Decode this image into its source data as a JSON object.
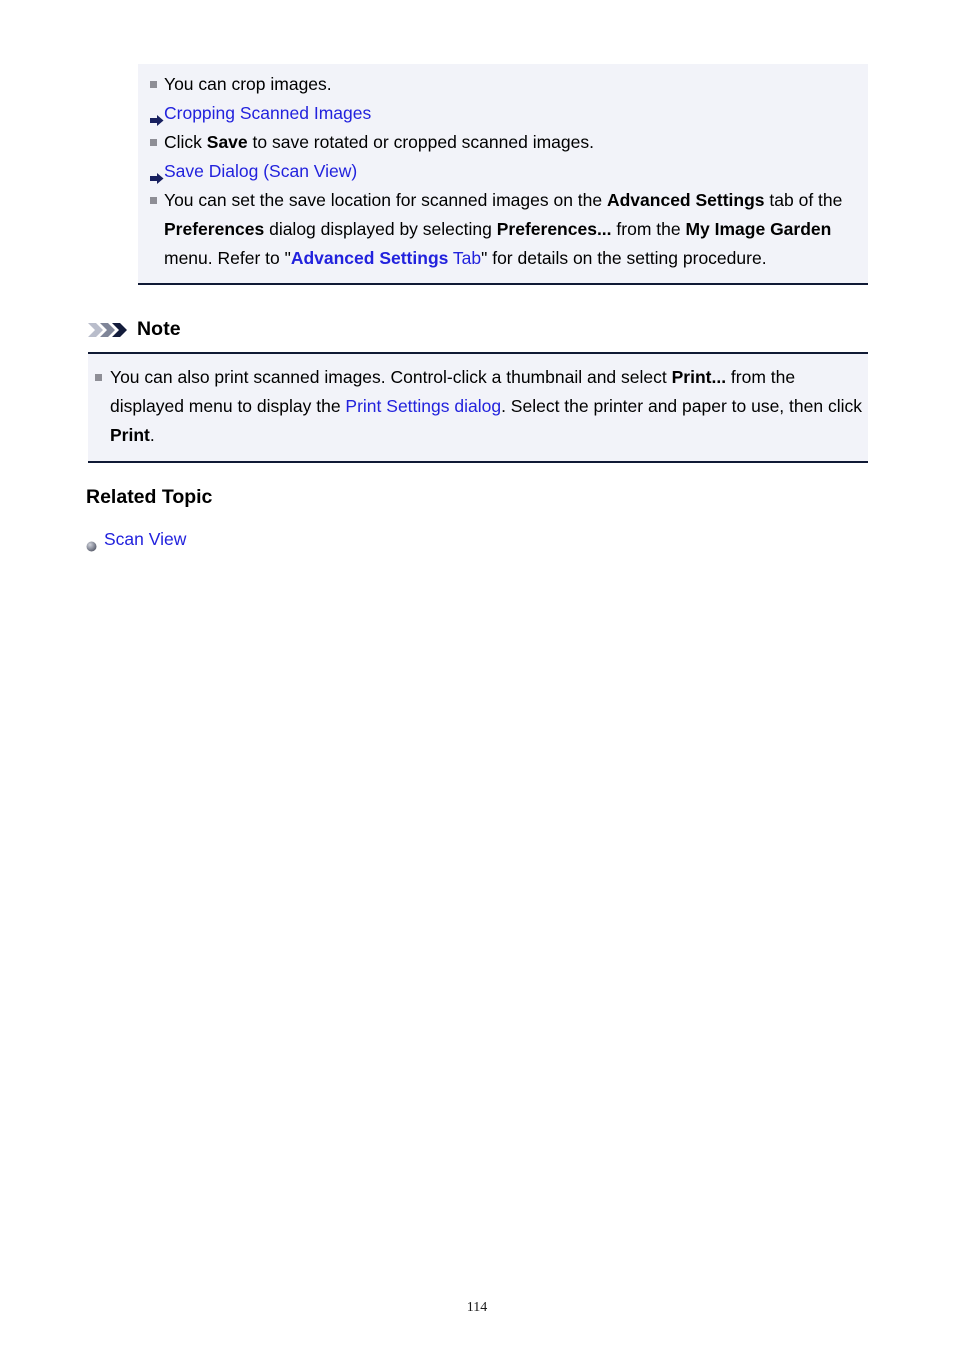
{
  "page": {
    "number": "114"
  },
  "info_panel": {
    "items": [
      {
        "type": "bullet",
        "segments": [
          {
            "text": "You can crop images.",
            "style": "normal"
          }
        ]
      },
      {
        "type": "arrow-link",
        "icon": "arrow-right-icon",
        "segments": [
          {
            "text": "Cropping Scanned Images",
            "style": "link"
          }
        ]
      },
      {
        "type": "bullet",
        "segments": [
          {
            "text": "Click ",
            "style": "normal"
          },
          {
            "text": "Save",
            "style": "bold"
          },
          {
            "text": " to save rotated or cropped scanned images.",
            "style": "normal"
          }
        ]
      },
      {
        "type": "arrow-link",
        "icon": "arrow-right-icon",
        "segments": [
          {
            "text": "Save Dialog (Scan View)",
            "style": "link"
          }
        ]
      },
      {
        "type": "bullet",
        "segments": [
          {
            "text": "You can set the save location for scanned images on the ",
            "style": "normal"
          },
          {
            "text": "Advanced Settings",
            "style": "bold"
          },
          {
            "text": " tab of the ",
            "style": "normal"
          },
          {
            "text": "Preferences",
            "style": "bold"
          },
          {
            "text": " dialog displayed by selecting ",
            "style": "normal"
          },
          {
            "text": "Preferences...",
            "style": "bold"
          },
          {
            "text": " from the ",
            "style": "normal"
          },
          {
            "text": "My Image Garden",
            "style": "bold"
          },
          {
            "text": " menu. Refer to \"",
            "style": "normal"
          },
          {
            "text": "Advanced Settings",
            "style": "link-bold"
          },
          {
            "text": " Tab",
            "style": "link"
          },
          {
            "text": "\" for details on the setting procedure.",
            "style": "normal"
          }
        ]
      }
    ]
  },
  "note_section": {
    "icon": "triple-chevron-icon",
    "title": "Note",
    "items": [
      {
        "type": "bullet",
        "segments": [
          {
            "text": "You can also print scanned images. Control-click a thumbnail and select ",
            "style": "normal"
          },
          {
            "text": "Print...",
            "style": "bold"
          },
          {
            "text": " from the displayed menu to display the ",
            "style": "normal"
          },
          {
            "text": "Print Settings dialog",
            "style": "link"
          },
          {
            "text": ". Select the printer and paper to use, then click ",
            "style": "normal"
          },
          {
            "text": "Print",
            "style": "bold"
          },
          {
            "text": ".",
            "style": "normal"
          }
        ]
      }
    ]
  },
  "related_topic": {
    "title": "Related Topic",
    "links": [
      {
        "icon": "sphere-bullet-icon",
        "label": "Scan View"
      }
    ]
  },
  "colors": {
    "link": "#2222dd",
    "link_bold": "#1a1ad0",
    "panel_background": "#f2f3f9",
    "panel_border": "#101a35",
    "bullet_gray": "#8e8e96",
    "arrow_navy": "#182060"
  }
}
